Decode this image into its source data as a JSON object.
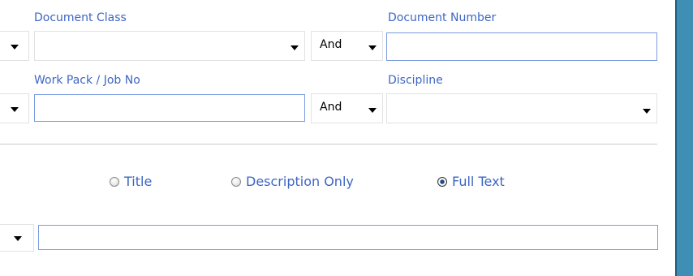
{
  "fields": {
    "document_class_label": "Document Class",
    "document_number_label": "Document Number",
    "work_pack_label": "Work Pack / Job No",
    "discipline_label": "Discipline",
    "operator_1": "And",
    "operator_2": "And",
    "document_class_value": "",
    "document_number_value": "",
    "work_pack_value": "",
    "discipline_value": "",
    "search_value": ""
  },
  "search_scope": {
    "options": [
      "Title",
      "Description Only",
      "Full Text"
    ],
    "selected": "Full Text"
  },
  "colors": {
    "label": "#3e66c4",
    "frame": "#3f8fb4",
    "input_border": "#7a9be0"
  }
}
